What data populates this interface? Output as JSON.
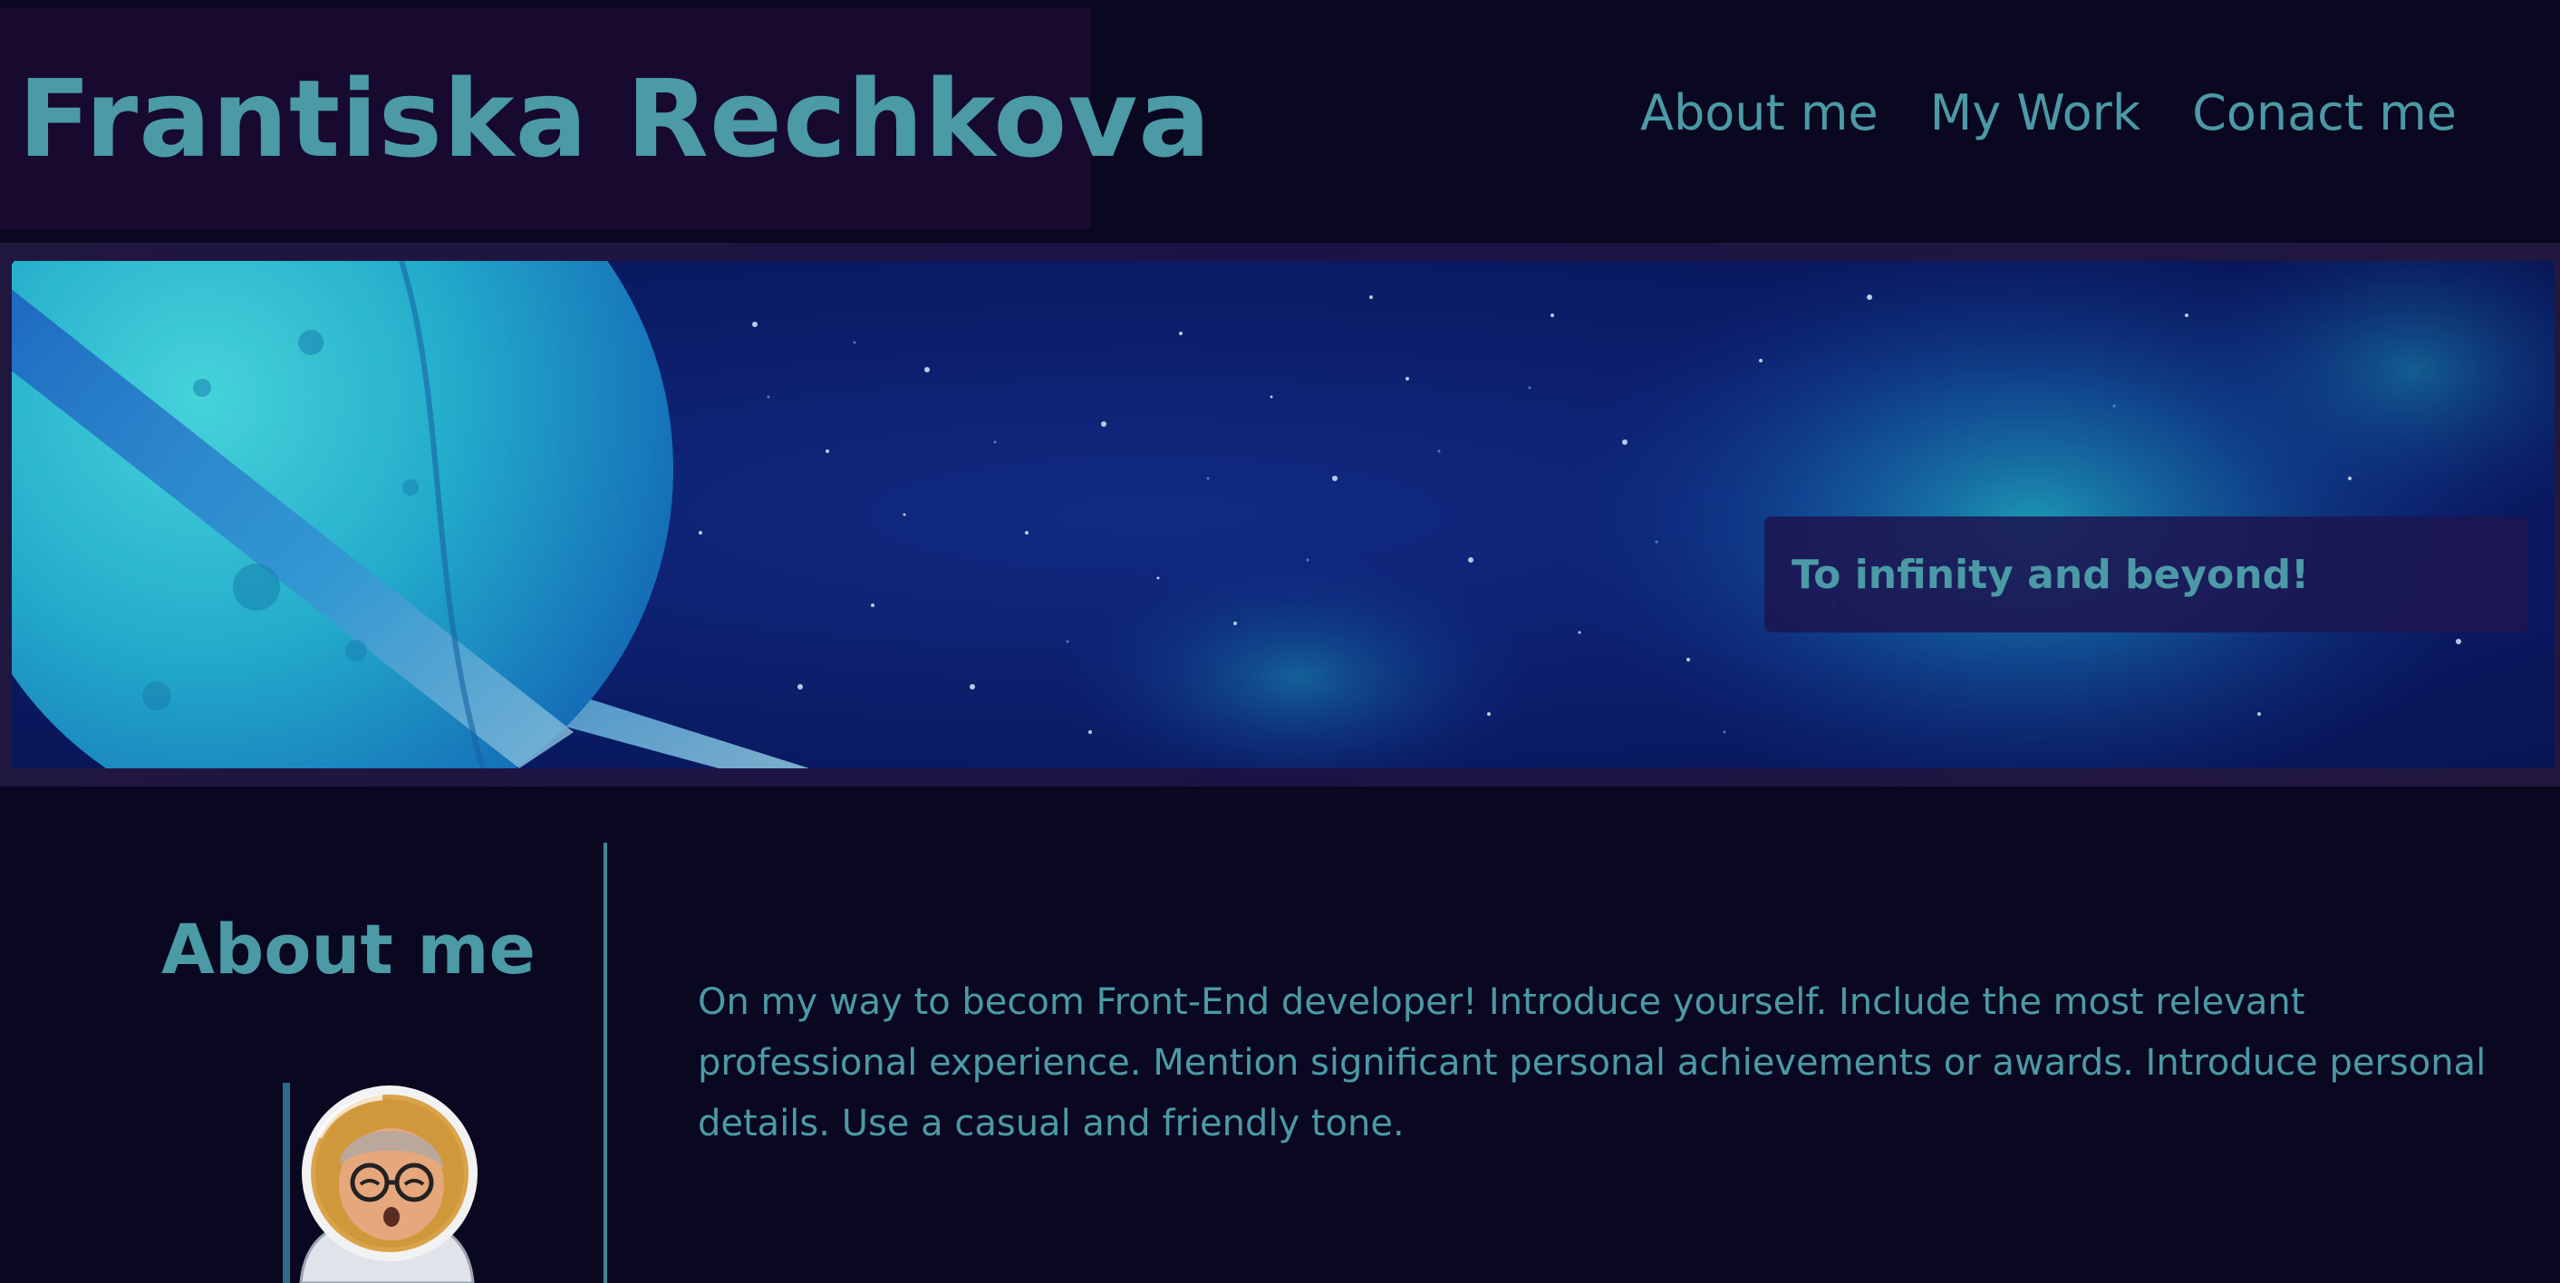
{
  "site": {
    "title": "Frantiska Rechkova"
  },
  "nav": {
    "items": [
      {
        "label": "About me"
      },
      {
        "label": "My Work"
      },
      {
        "label": "Conact me"
      }
    ]
  },
  "hero": {
    "tagline": "To infinity and beyond!"
  },
  "about": {
    "heading": "About me",
    "body": "On my way to becom Front-End developer! Introduce yourself. Include the most relevant professional experience. Mention significant personal achievements or awards. Introduce personal details. Use a casual and friendly tone."
  },
  "colors": {
    "background": "#0a0720",
    "brand_bg": "#170a2e",
    "accent_text": "#4b9aa6"
  },
  "icons": {
    "avatar": "astronaut-avatar-icon"
  }
}
